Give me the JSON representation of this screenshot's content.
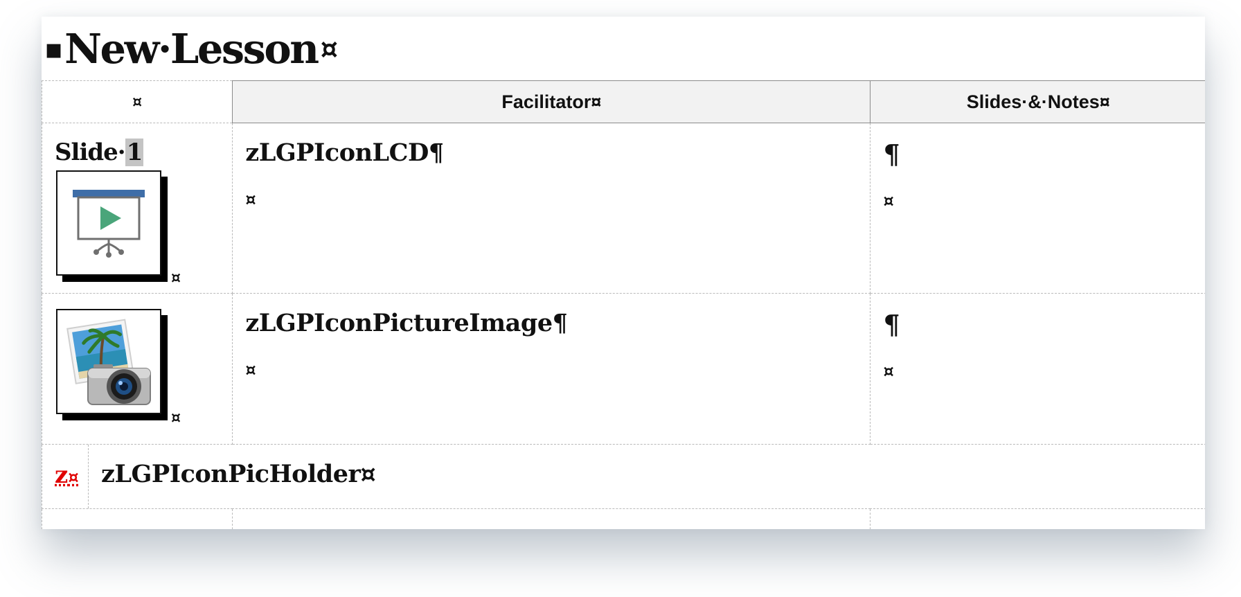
{
  "document": {
    "title_mark": "▪",
    "title": "New·Lesson",
    "title_end": "¤"
  },
  "table": {
    "headers": {
      "blank": "¤",
      "facilitator": "Facilitator¤",
      "slides_notes": "Slides·&·Notes¤"
    },
    "rows": [
      {
        "label_prefix": "Slide·",
        "label_num": "1",
        "icon": "presentation-icon",
        "cell_mark": "¤",
        "facilitator_code": "zLGPIconLCD¶",
        "facilitator_mark": "¤",
        "notes_pilcrow": "¶",
        "notes_mark": "¤"
      },
      {
        "icon": "photo-camera-icon",
        "cell_mark": "¤",
        "facilitator_code": "zLGPIconPictureImage¶",
        "facilitator_mark": "¤",
        "notes_pilcrow": "¶",
        "notes_mark": "¤"
      }
    ],
    "holder_row": {
      "z": "z",
      "z_mark": "¤",
      "text": "zLGPIconPicHolder¤"
    }
  },
  "colors": {
    "header_bg": "#f2f2f2",
    "accent_red": "#e00000",
    "projector_bar": "#3f6ea8",
    "play_green": "#4aa57a"
  }
}
